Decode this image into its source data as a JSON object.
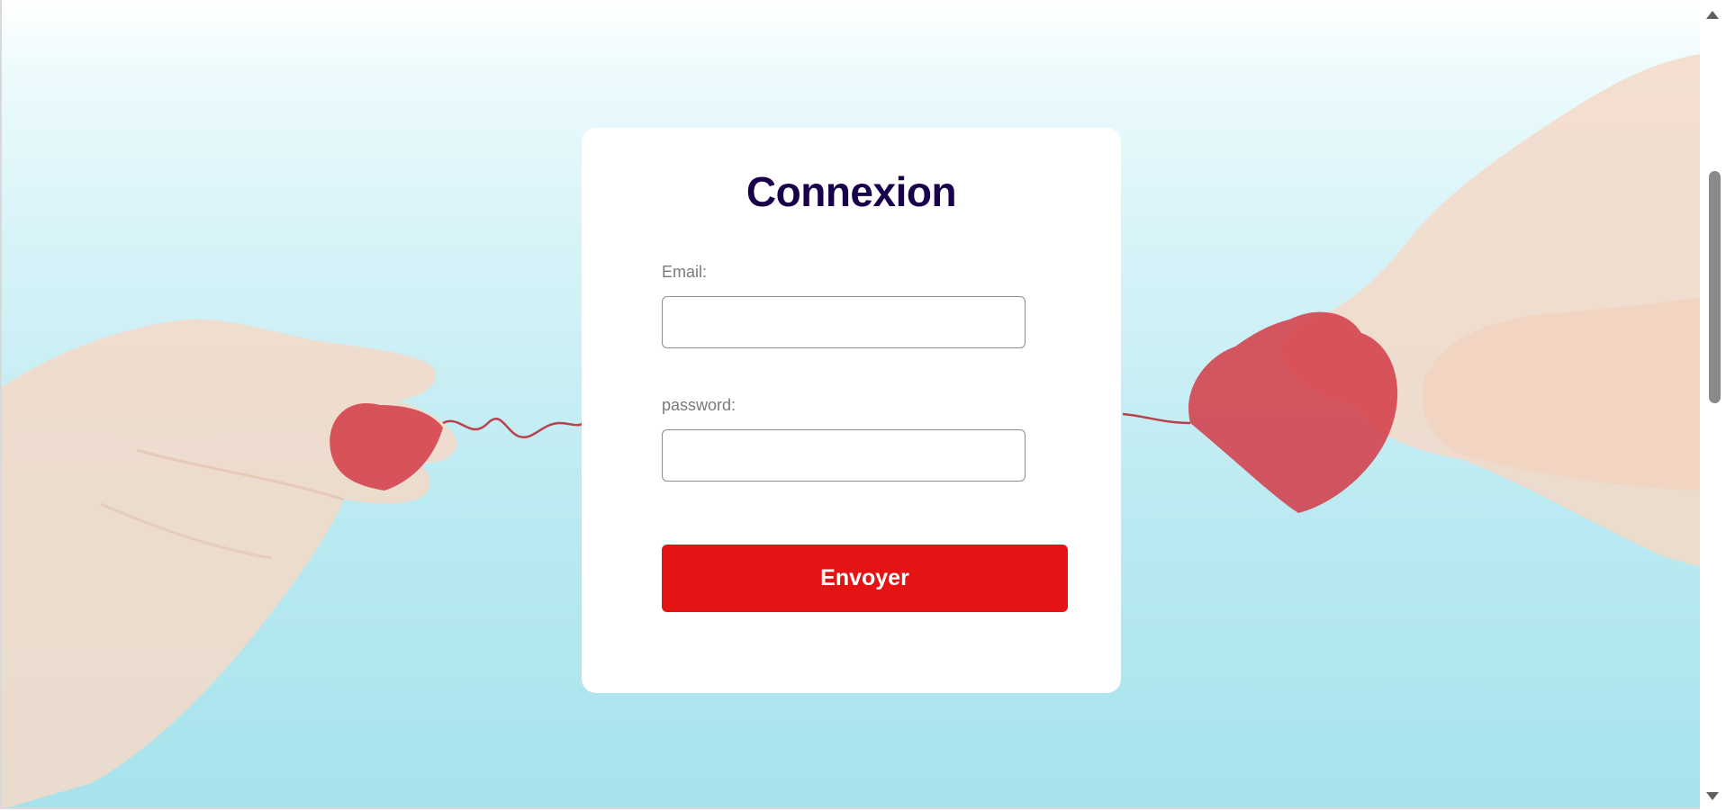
{
  "login": {
    "title": "Connexion",
    "email_label": "Email:",
    "email_value": "",
    "password_label": "password:",
    "password_value": "",
    "submit_label": "Envoyer"
  },
  "colors": {
    "title": "#18004a",
    "button": "#e51313",
    "background_top": "#ffffff",
    "background_bottom": "#a7e2ec"
  },
  "icons": [
    "scroll-up-arrow-icon",
    "scroll-down-arrow-icon"
  ]
}
